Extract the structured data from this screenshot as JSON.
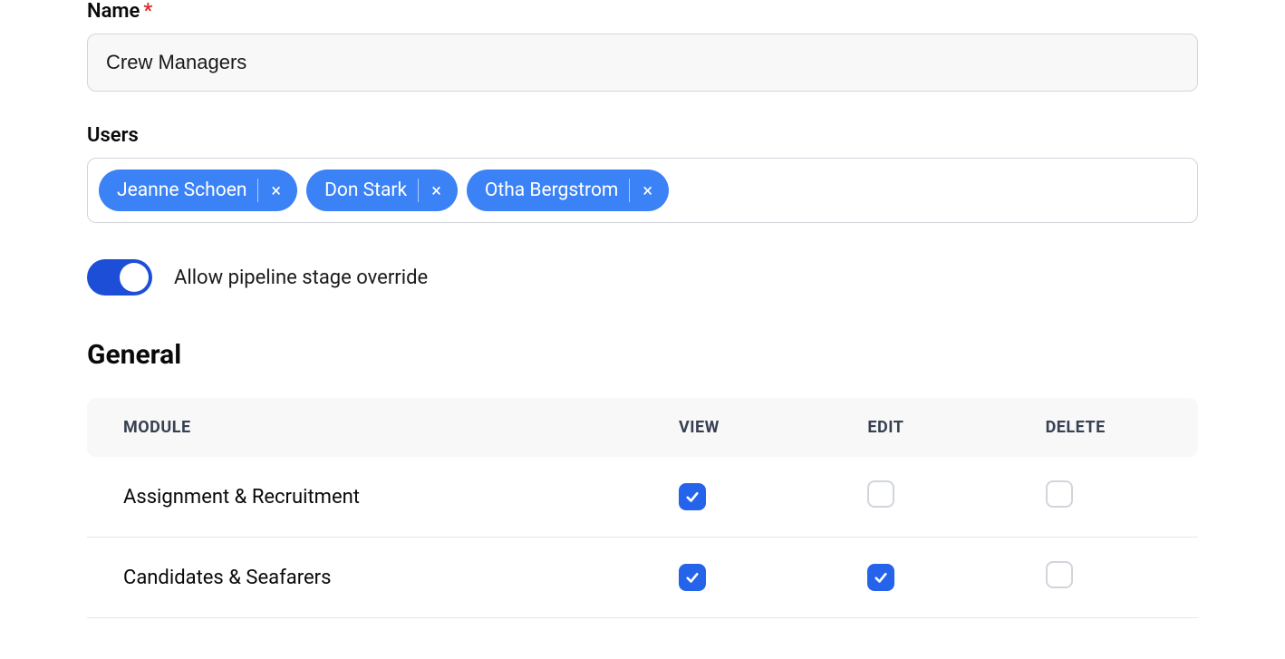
{
  "name_field": {
    "label": "Name",
    "value": "Crew Managers"
  },
  "users_field": {
    "label": "Users",
    "tags": [
      {
        "name": "Jeanne Schoen"
      },
      {
        "name": "Don Stark"
      },
      {
        "name": "Otha Bergstrom"
      }
    ]
  },
  "toggle": {
    "label": "Allow pipeline stage override",
    "on": true
  },
  "general": {
    "heading": "General",
    "columns": {
      "module": "MODULE",
      "view": "VIEW",
      "edit": "EDIT",
      "delete": "DELETE"
    },
    "rows": [
      {
        "module": "Assignment & Recruitment",
        "view": true,
        "edit": false,
        "delete": false
      },
      {
        "module": "Candidates & Seafarers",
        "view": true,
        "edit": true,
        "delete": false
      }
    ]
  }
}
